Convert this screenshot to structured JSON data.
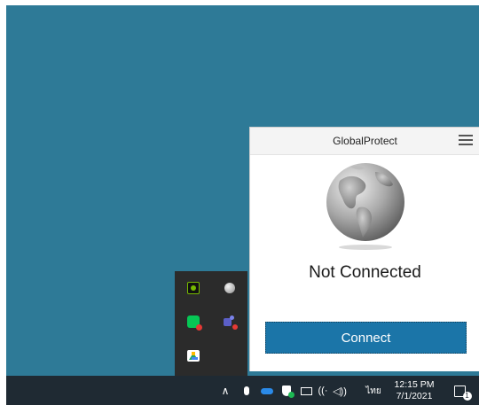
{
  "gp": {
    "title": "GlobalProtect",
    "status": "Not Connected",
    "connect_label": "Connect"
  },
  "tray": {
    "overflow_icons": [
      "nvidia-icon",
      "globe-status-icon",
      "line-app-icon",
      "teams-icon",
      "google-drive-icon"
    ]
  },
  "taskbar": {
    "icons": [
      "show-hidden-icons-chevron",
      "microphone-icon",
      "onedrive-cloud-icon",
      "defender-shield-icon",
      "battery-icon",
      "wifi-icon",
      "volume-icon"
    ],
    "language": "ไทย",
    "time": "12:15 PM",
    "date": "7/1/2021",
    "notification_count": "1"
  },
  "colors": {
    "desktop": "#2e7a97",
    "taskbar": "#1f2a33",
    "connect_button": "#1b75a8"
  }
}
